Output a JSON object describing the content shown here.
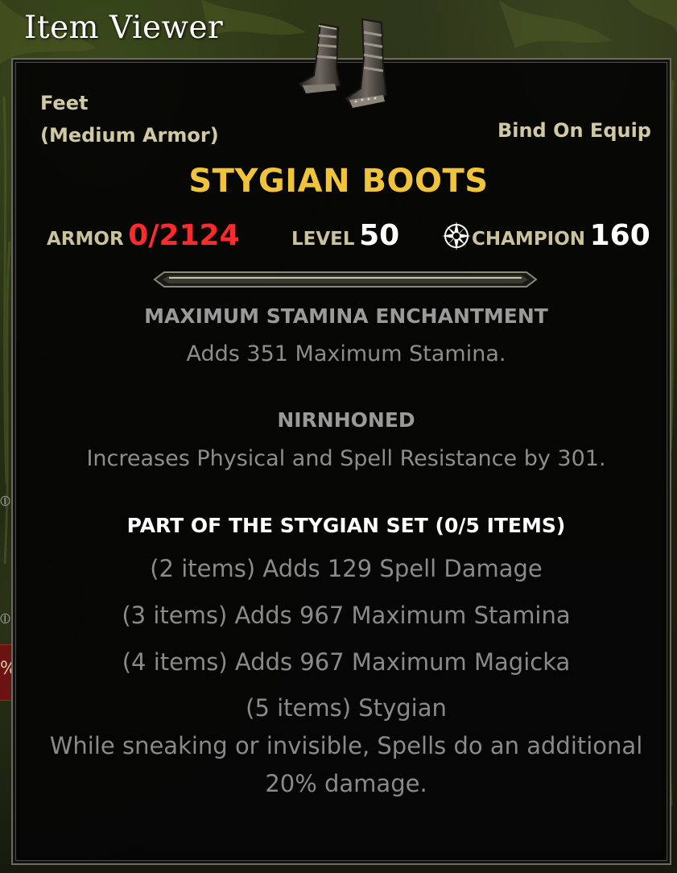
{
  "window": {
    "title": "Item Viewer"
  },
  "side": {
    "badge_text": "%"
  },
  "item": {
    "icon": "boots-icon",
    "slot": "Feet",
    "armor_type": "(Medium Armor)",
    "bind": "Bind On Equip",
    "name": "STYGIAN BOOTS",
    "name_color": "#f0c43a"
  },
  "stats": {
    "armor_label": "ARMOR",
    "armor_value": "0/2124",
    "armor_value_color": "#ff2a2a",
    "level_label": "LEVEL",
    "level_value": "50",
    "champion_icon": "champion-star-icon",
    "champion_label": "CHAMPION",
    "champion_value": "160"
  },
  "enchantment": {
    "title": "MAXIMUM STAMINA ENCHANTMENT",
    "description": "Adds 351 Maximum Stamina."
  },
  "trait": {
    "title": "NIRNHONED",
    "description": "Increases Physical and Spell Resistance by 301."
  },
  "set": {
    "title": "PART OF THE STYGIAN SET (0/5 ITEMS)",
    "bonuses": [
      "(2 items) Adds 129 Spell Damage",
      "(3 items) Adds 967 Maximum Stamina",
      "(4 items) Adds 967 Maximum Magicka"
    ],
    "final_bonus_title": "(5 items) Stygian",
    "final_bonus_line1": "While sneaking or invisible, Spells do an additional",
    "final_bonus_line2": "20% damage."
  }
}
